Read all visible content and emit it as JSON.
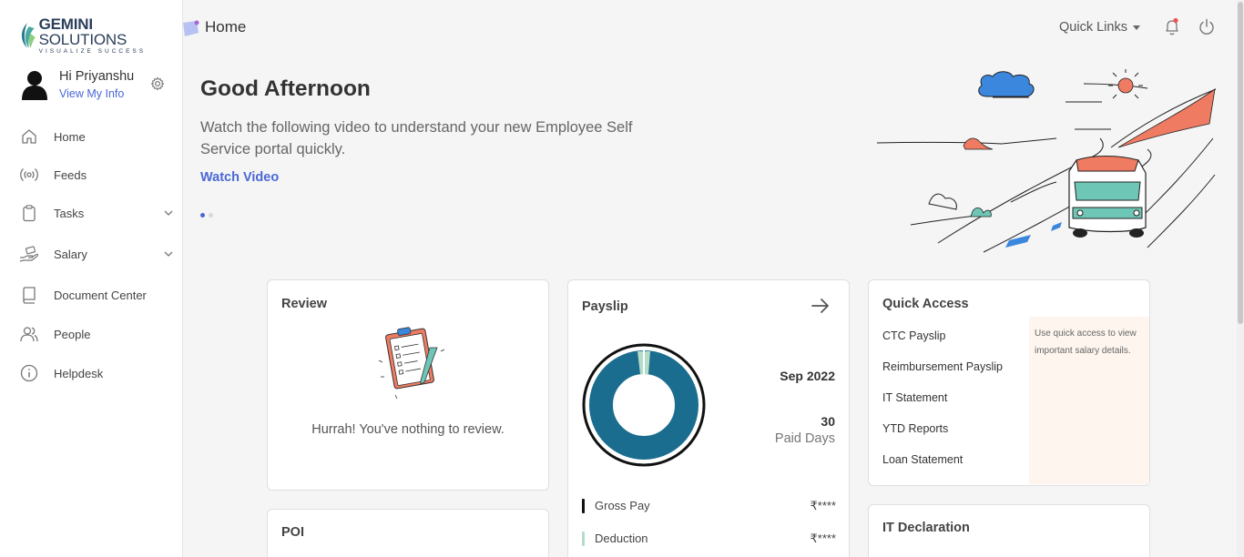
{
  "brand": {
    "name_bold": "GEMINI",
    "name_rest": " SOLUTIONS",
    "tagline": "VISUALIZE SUCCESS"
  },
  "user": {
    "greeting": "Hi Priyanshu",
    "view_info": "View My Info"
  },
  "nav": {
    "items": [
      {
        "label": "Home",
        "icon": "home-icon"
      },
      {
        "label": "Feeds",
        "icon": "broadcast-icon"
      },
      {
        "label": "Tasks",
        "icon": "clipboard-icon",
        "expandable": true
      },
      {
        "label": "Salary",
        "icon": "hand-money-icon",
        "expandable": true
      },
      {
        "label": "Document Center",
        "icon": "book-icon"
      },
      {
        "label": "People",
        "icon": "people-icon"
      },
      {
        "label": "Helpdesk",
        "icon": "info-icon"
      }
    ]
  },
  "header": {
    "title": "Home",
    "quick_links": "Quick Links"
  },
  "hero": {
    "greeting": "Good Afternoon",
    "subtitle": "Watch the following video to understand your new Employee Self Service portal quickly.",
    "cta": "Watch Video"
  },
  "review": {
    "title": "Review",
    "message": "Hurrah! You've nothing to review."
  },
  "payslip": {
    "title": "Payslip",
    "month": "Sep 2022",
    "paid_days": "30",
    "paid_days_label": "Paid Days",
    "gross_label": "Gross Pay",
    "gross_value": "₹****",
    "deduction_label": "Deduction",
    "deduction_value": "₹****",
    "colors": {
      "gross": "#1b6d8f",
      "deduction": "#b5dcc8"
    }
  },
  "quick_access": {
    "title": "Quick Access",
    "links": [
      "CTC Payslip",
      "Reimbursement Payslip",
      "IT Statement",
      "YTD Reports",
      "Loan Statement"
    ],
    "hint": "Use quick access to view important salary details."
  },
  "poi": {
    "title": "POI"
  },
  "it_declaration": {
    "title": "IT Declaration"
  },
  "colors": {
    "accent": "#4a68d6",
    "notification": "#f0524f"
  }
}
